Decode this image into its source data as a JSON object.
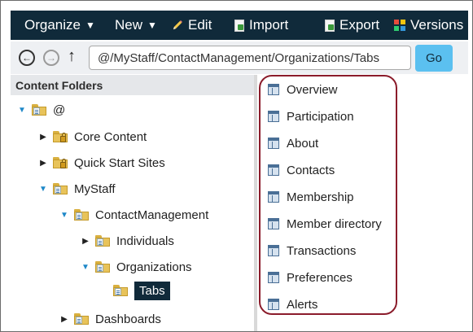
{
  "toolbar": {
    "organize_label": "Organize",
    "new_label": "New",
    "edit_label": "Edit",
    "import_label": "Import",
    "export_label": "Export",
    "versions_label": "Versions"
  },
  "address_bar": {
    "path_value": "@/MyStaff/ContactManagement/Organizations/Tabs",
    "go_label": "Go"
  },
  "content_folders": {
    "header": "Content Folders",
    "items": [
      {
        "label": "@",
        "state": "open",
        "icon": "folder-icon"
      },
      {
        "label": "Core Content",
        "state": "closed",
        "icon": "locked-folder-icon"
      },
      {
        "label": "Quick Start Sites",
        "state": "closed",
        "icon": "locked-folder-icon"
      },
      {
        "label": "MyStaff",
        "state": "open",
        "icon": "folder-icon"
      },
      {
        "label": "ContactManagement",
        "state": "open",
        "icon": "folder-icon"
      },
      {
        "label": "Individuals",
        "state": "closed",
        "icon": "folder-icon"
      },
      {
        "label": "Organizations",
        "state": "open",
        "icon": "folder-icon"
      },
      {
        "label": "Tabs",
        "state": "leaf",
        "icon": "folder-icon",
        "selected": true
      },
      {
        "label": "Dashboards",
        "state": "closed",
        "icon": "folder-icon"
      }
    ]
  },
  "tabs_list": {
    "items": [
      {
        "label": "Overview"
      },
      {
        "label": "Participation"
      },
      {
        "label": "About"
      },
      {
        "label": "Contacts"
      },
      {
        "label": "Membership"
      },
      {
        "label": "Member directory"
      },
      {
        "label": "Transactions"
      },
      {
        "label": "Preferences"
      },
      {
        "label": "Alerts"
      }
    ]
  },
  "colors": {
    "toolbar_bg": "#102a3a",
    "go_button": "#5bc0f0",
    "highlight_border": "#8b1c2b",
    "selected_bg": "#102a3a"
  }
}
